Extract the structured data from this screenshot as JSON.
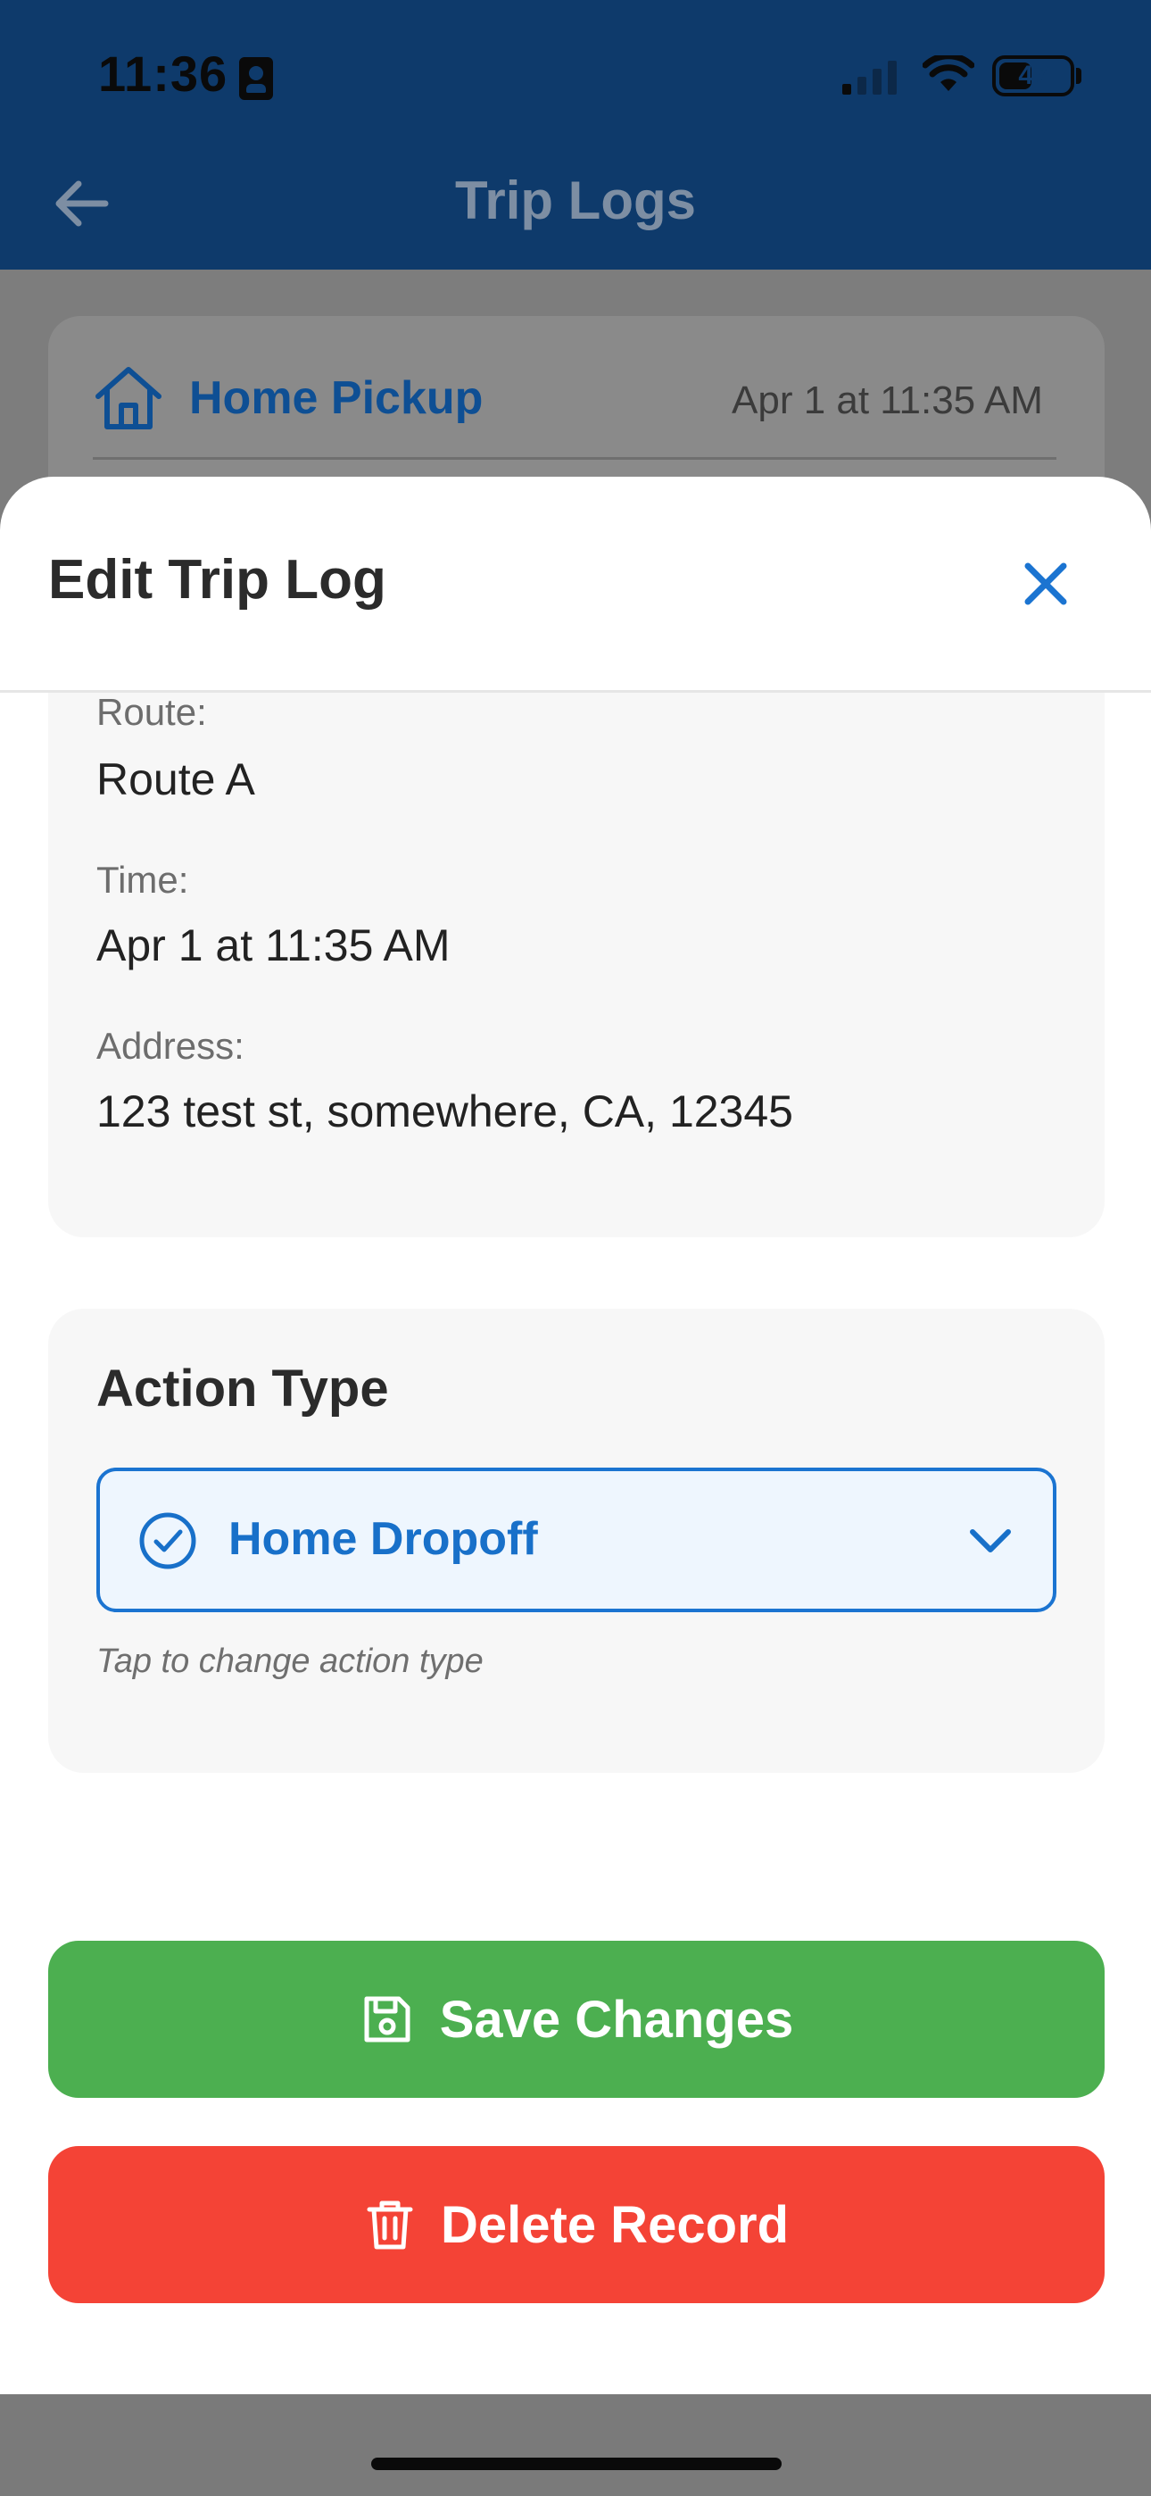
{
  "status_bar": {
    "time": "11:36",
    "battery_level": "47",
    "battery_fraction": 0.47
  },
  "header": {
    "title": "Trip Logs"
  },
  "background_card": {
    "title": "Home Pickup",
    "timestamp": "Apr 1 at 11:35 AM"
  },
  "sheet": {
    "title": "Edit Trip Log",
    "fields": [
      {
        "label": "Route:",
        "value": "Route A"
      },
      {
        "label": "Time:",
        "value": "Apr 1 at 11:35 AM"
      },
      {
        "label": "Address:",
        "value": "123 test st, somewhere, CA, 12345"
      }
    ],
    "action_type": {
      "heading": "Action Type",
      "selected": "Home Dropoff",
      "helper": "Tap to change action type"
    },
    "buttons": {
      "save_label": "Save Changes",
      "delete_label": "Delete Record"
    }
  },
  "colors": {
    "header_bg": "#0e3a6b",
    "accent_blue": "#1b74d1",
    "save_green": "#4caf50",
    "delete_red": "#f44336"
  },
  "icons": [
    "back-arrow-icon",
    "home-icon",
    "close-icon",
    "check-circle-icon",
    "chevron-down-icon",
    "save-icon",
    "trash-icon"
  ]
}
